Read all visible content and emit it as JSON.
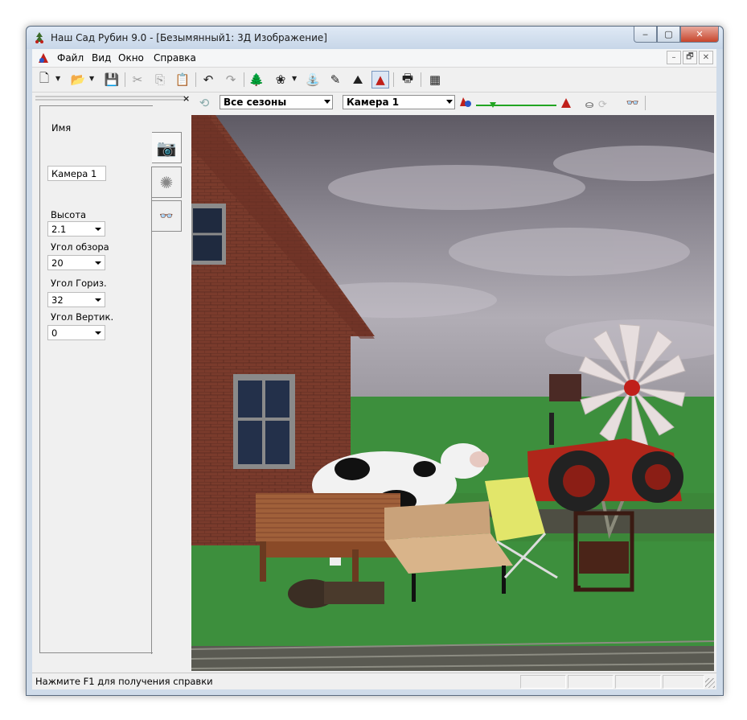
{
  "window": {
    "title": "Наш Сад Рубин 9.0 - [Безымянный1: 3Д Изображение]",
    "caption_buttons": {
      "minimize": "‒",
      "maximize": "▢",
      "close": "✕"
    }
  },
  "menubar": {
    "items": [
      "Файл",
      "Вид",
      "Окно",
      "Справка"
    ],
    "mdi_buttons": [
      "–",
      "🗗",
      "✕"
    ]
  },
  "toolbar": {
    "icons": [
      "new-icon",
      "open-icon",
      "save-icon",
      "cut-icon",
      "copy-icon",
      "paste-icon",
      "undo-icon",
      "redo-icon",
      "plant-catalog-icon",
      "flower-icon",
      "objects-icon",
      "notes-icon",
      "terrain-icon",
      "3d-view-icon",
      "print-icon",
      "calculator-icon"
    ],
    "glyphs": {
      "new": "🗋",
      "open": "📂",
      "save": "💾",
      "cut": "✂",
      "copy": "⎘",
      "paste": "📋",
      "undo": "↶",
      "redo": "↷",
      "plant": "🌲",
      "flower": "❀",
      "objects": "⛲",
      "notes": "✎",
      "terrain": "⛰",
      "view3d": "▲",
      "print": "🖶",
      "calc": "▦"
    }
  },
  "toolbar2": {
    "season_combo": "Все сезоны",
    "camera_combo": "Камера 1",
    "glyphs": {
      "refresh": "⟲",
      "lights_left": "▲",
      "lights_right": "▲",
      "glasses": "👓"
    }
  },
  "panel": {
    "close_glyph": "×",
    "name_label": "Имя",
    "name_value": "Камера 1",
    "height_label": "Высота",
    "height_value": "2.1",
    "fov_label": "Угол обзора",
    "fov_value": "20",
    "hangle_label": "Угол Гориз.",
    "hangle_value": "32",
    "vangle_label": "Угол Вертик.",
    "vangle_value": "0",
    "tabs": [
      "camera-icon",
      "sun-icon",
      "glasses-icon"
    ],
    "tab_glyphs": [
      "📷",
      "✺",
      "👓"
    ]
  },
  "status": {
    "text": "Нажмите F1 для получения справки"
  },
  "colors": {
    "sky": "#6f6d77",
    "grass": "#3d8f3d",
    "brick": "#7a3b2c",
    "tractor": "#b0261a",
    "windmill": "#e7dede"
  }
}
